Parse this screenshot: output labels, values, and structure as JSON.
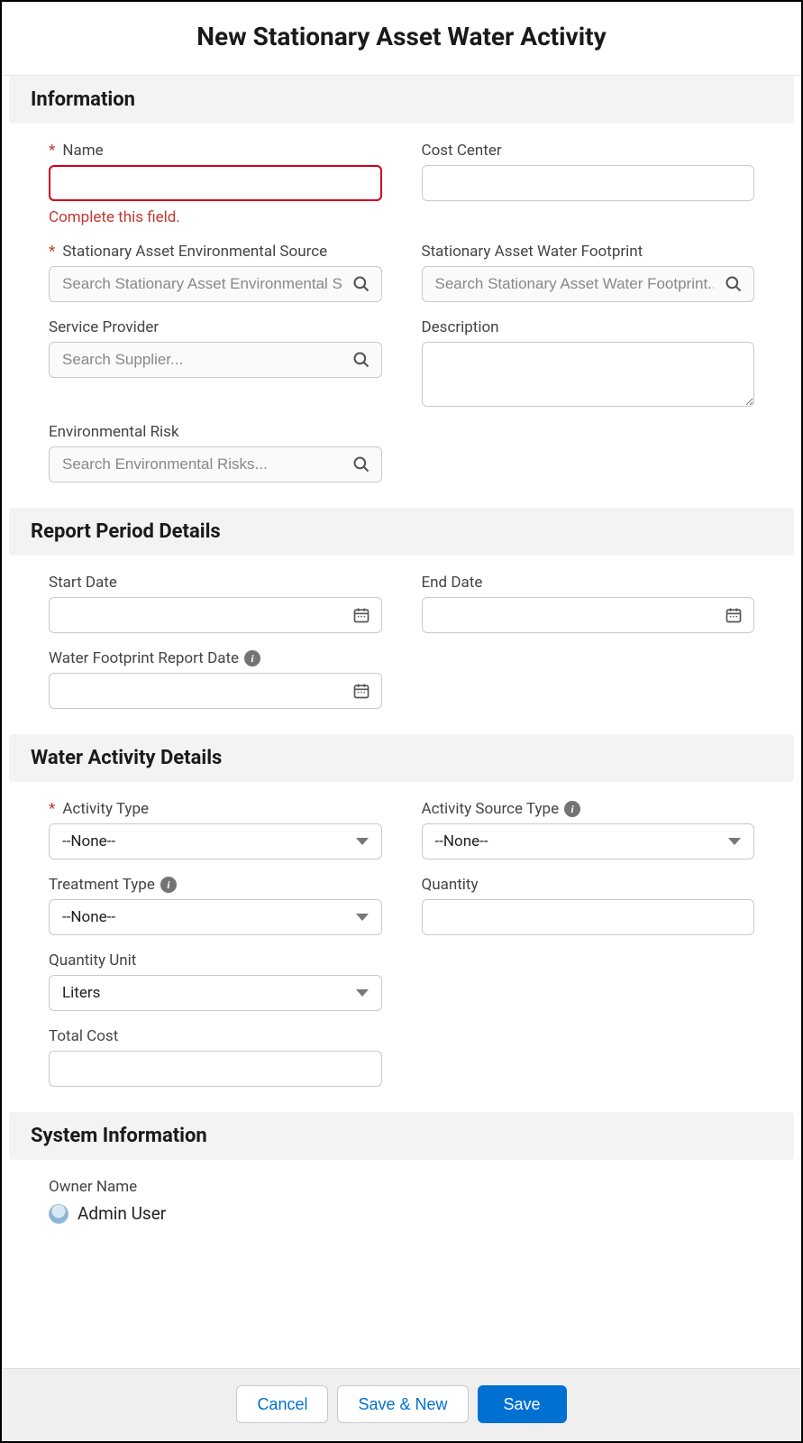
{
  "header": {
    "title": "New Stationary Asset Water Activity"
  },
  "sections": {
    "information": {
      "title": "Information"
    },
    "report": {
      "title": "Report Period Details"
    },
    "water": {
      "title": "Water Activity Details"
    },
    "system": {
      "title": "System Information"
    }
  },
  "fields": {
    "name": {
      "label": "Name",
      "value": "",
      "error": "Complete this field."
    },
    "cost_center": {
      "label": "Cost Center",
      "value": ""
    },
    "env_source": {
      "label": "Stationary Asset Environmental Source",
      "placeholder": "Search Stationary Asset Environmental Source..."
    },
    "water_footprint": {
      "label": "Stationary Asset Water Footprint",
      "placeholder": "Search Stationary Asset Water Footprint..."
    },
    "service_provider": {
      "label": "Service Provider",
      "placeholder": "Search Supplier..."
    },
    "description": {
      "label": "Description",
      "value": ""
    },
    "env_risk": {
      "label": "Environmental Risk",
      "placeholder": "Search Environmental Risks..."
    },
    "start_date": {
      "label": "Start Date",
      "value": ""
    },
    "end_date": {
      "label": "End Date",
      "value": ""
    },
    "wf_report_date": {
      "label": "Water Footprint Report Date",
      "value": ""
    },
    "activity_type": {
      "label": "Activity Type",
      "value": "--None--"
    },
    "activity_source_type": {
      "label": "Activity Source Type",
      "value": "--None--"
    },
    "treatment_type": {
      "label": "Treatment Type",
      "value": "--None--"
    },
    "quantity": {
      "label": "Quantity",
      "value": ""
    },
    "quantity_unit": {
      "label": "Quantity Unit",
      "value": "Liters"
    },
    "total_cost": {
      "label": "Total Cost",
      "value": ""
    },
    "owner_name": {
      "label": "Owner Name",
      "value": "Admin User"
    }
  },
  "footer": {
    "cancel": "Cancel",
    "save_new": "Save & New",
    "save": "Save"
  }
}
